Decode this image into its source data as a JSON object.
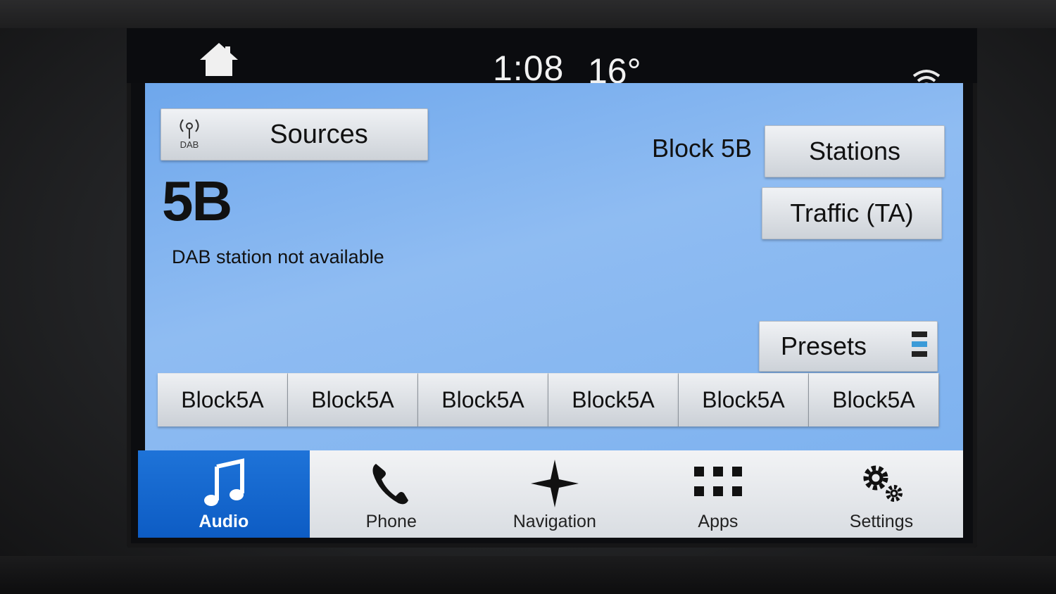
{
  "status_bar": {
    "time": "1:08",
    "temperature": "16°"
  },
  "source": {
    "label": "Sources",
    "badge": "DAB"
  },
  "station": {
    "name": "5B",
    "message": "DAB station not available",
    "block": "Block 5B"
  },
  "buttons": {
    "stations": "Stations",
    "traffic": "Traffic (TA)",
    "presets": "Presets"
  },
  "presets": [
    "Block5A",
    "Block5A",
    "Block5A",
    "Block5A",
    "Block5A",
    "Block5A"
  ],
  "nav": [
    {
      "label": "Audio",
      "icon": "music-note-icon",
      "active": true
    },
    {
      "label": "Phone",
      "icon": "phone-icon",
      "active": false
    },
    {
      "label": "Navigation",
      "icon": "compass-star-icon",
      "active": false
    },
    {
      "label": "Apps",
      "icon": "grid-icon",
      "active": false
    },
    {
      "label": "Settings",
      "icon": "gears-icon",
      "active": false
    }
  ],
  "colors": {
    "accent": "#1565d0",
    "content_bg": "#7eb2ef",
    "preset_indicator": "#3b9bd8"
  }
}
